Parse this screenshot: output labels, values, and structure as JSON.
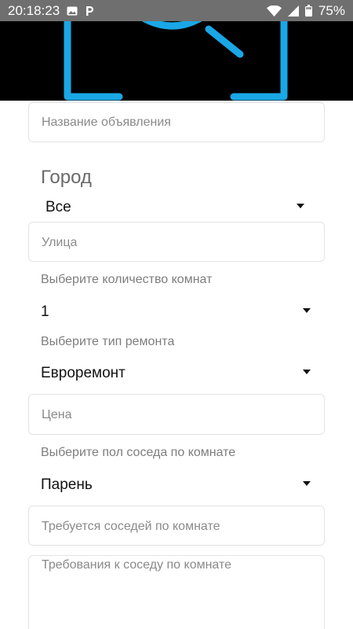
{
  "status_bar": {
    "time": "20:18:23",
    "battery": "75%",
    "icons": [
      "image-icon",
      "parking-icon",
      "wifi-icon",
      "signal-icon",
      "battery-icon"
    ]
  },
  "header": {
    "image": "search-logo-image",
    "accent_color": "#1aa7e6"
  },
  "form": {
    "title_placeholder": "Название объявления",
    "city_label": "Город",
    "city_value": "Все",
    "street_placeholder": "Улица",
    "rooms_label": "Выберите количество комнат",
    "rooms_value": "1",
    "repair_label": "Выберите тип ремонта",
    "repair_value": "Евроремонт",
    "price_placeholder": "Цена",
    "gender_label": "Выберите пол соседа по комнате",
    "gender_value": "Парень",
    "neighbors_placeholder": "Требуется соседей по комнате",
    "requirements_placeholder": "Требования к соседу по комнате"
  }
}
